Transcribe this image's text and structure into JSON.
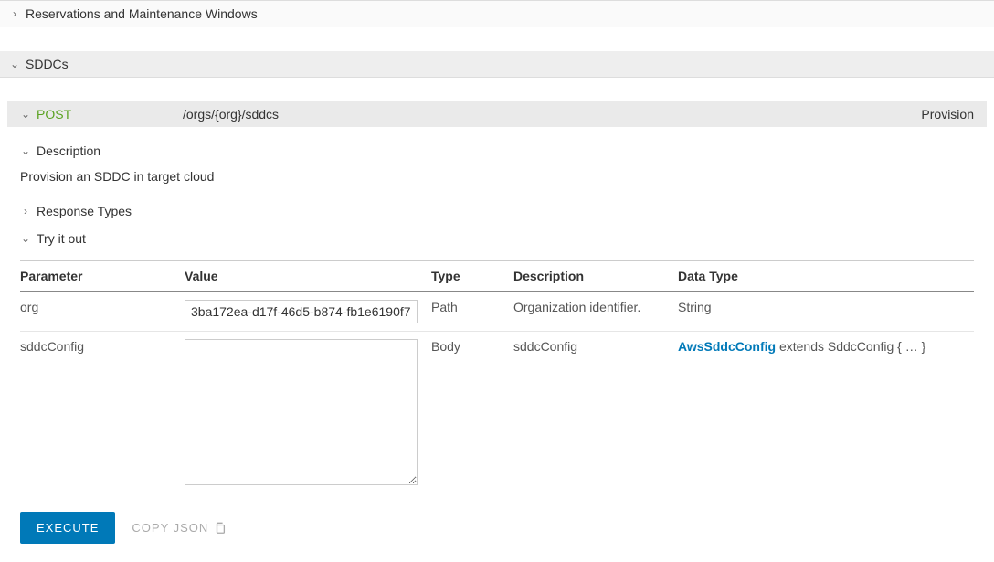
{
  "panels": {
    "reservations": "Reservations and Maintenance Windows",
    "sddcs": "SDDCs"
  },
  "endpoint": {
    "method": "POST",
    "path": "/orgs/{org}/sddcs",
    "summary": "Provision"
  },
  "sections": {
    "description_label": "Description",
    "description_text": "Provision an SDDC in target cloud",
    "response_types": "Response Types",
    "try_it_out": "Try it out"
  },
  "table": {
    "headers": {
      "parameter": "Parameter",
      "value": "Value",
      "type": "Type",
      "description": "Description",
      "data_type": "Data Type"
    },
    "rows": [
      {
        "parameter": "org",
        "value": "3ba172ea-d17f-46d5-b874-fb1e6190f7",
        "type": "Path",
        "description": "Organization identifier.",
        "data_type": "String"
      },
      {
        "parameter": "sddcConfig",
        "value": "",
        "type": "Body",
        "description": "sddcConfig",
        "data_type_link": "AwsSddcConfig",
        "data_type_rest": " extends SddcConfig { … }"
      }
    ]
  },
  "actions": {
    "execute": "EXECUTE",
    "copy_json": "COPY JSON"
  }
}
